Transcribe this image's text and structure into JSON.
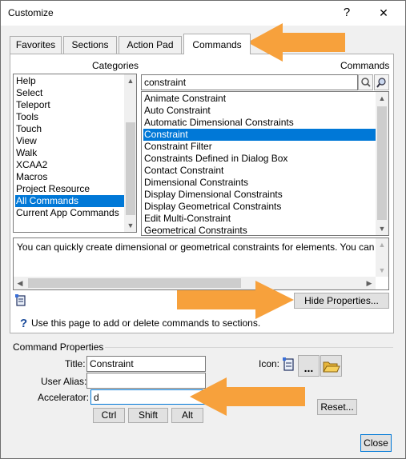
{
  "window": {
    "title": "Customize",
    "help_glyph": "?",
    "close_glyph": "✕"
  },
  "tabs": [
    {
      "label": "Favorites"
    },
    {
      "label": "Sections"
    },
    {
      "label": "Action Pad"
    },
    {
      "label": "Commands"
    }
  ],
  "categories": {
    "header": "Categories",
    "items": [
      "Help",
      "Select",
      "Teleport",
      "Tools",
      "Touch",
      "View",
      "Walk",
      "XCAA2",
      "Macros",
      "Project Resource",
      "All Commands",
      "Current App Commands"
    ],
    "selected": "All Commands"
  },
  "commands": {
    "header": "Commands",
    "search_value": "constraint",
    "items": [
      "Animate Constraint",
      "Auto Constraint",
      "Automatic Dimensional Constraints",
      "Constraint",
      "Constraint Filter",
      "Constraints Defined in Dialog Box",
      "Contact Constraint",
      "Dimensional Constraints",
      "Display Dimensional Constraints",
      "Display Geometrical Constraints",
      "Edit Multi-Constraint",
      "Geometrical Constraints"
    ],
    "selected": "Constraint"
  },
  "description": {
    "text": "You can quickly create dimensional or geometrical constraints for elements. You can"
  },
  "hide_properties_label": "Hide Properties...",
  "hint": {
    "text": "Use this page to add or delete commands to sections."
  },
  "command_properties": {
    "group_label": "Command Properties",
    "title_label": "Title:",
    "title_value": "Constraint",
    "alias_label": "User Alias:",
    "alias_value": "",
    "accelerator_label": "Accelerator:",
    "accelerator_value": "d",
    "ctrl_label": "Ctrl",
    "shift_label": "Shift",
    "alt_label": "Alt",
    "icon_label": "Icon:",
    "icon_more_label": "...",
    "reset_label": "Reset..."
  },
  "close_label": "Close",
  "colors": {
    "selection": "#0078d7",
    "annotation_arrow": "#f7a13c",
    "dialog_bg": "#f0f0f0"
  }
}
